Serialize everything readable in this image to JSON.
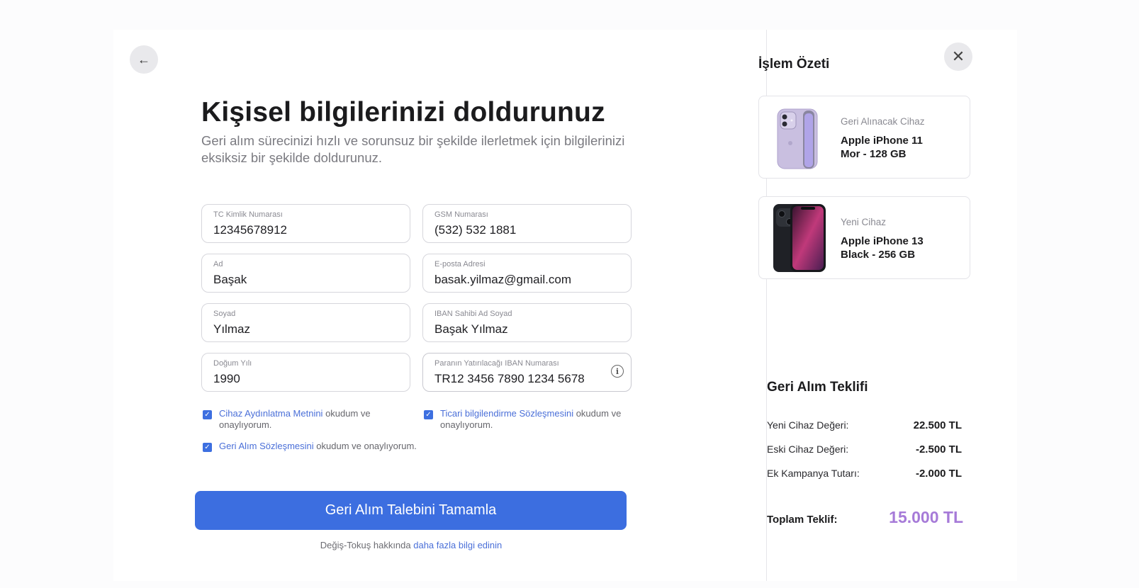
{
  "back_icon": "arrow-left-icon",
  "close_icon": "close-icon",
  "title": "Kişisel bilgilerinizi doldurunuz",
  "subtitle": "Geri alım sürecinizi hızlı ve sorunsuz bir şekilde ilerletmek için bilgilerinizi eksiksiz bir şekilde doldurunuz.",
  "form": {
    "tc": {
      "label": "TC Kimlik Numarası",
      "value": "12345678912"
    },
    "gsm": {
      "label": "GSM Numarası",
      "value": "(532) 532 1881"
    },
    "ad": {
      "label": "Ad",
      "value": "Başak"
    },
    "email": {
      "label": "E-posta Adresi",
      "value": "basak.yilmaz@gmail.com"
    },
    "soyad": {
      "label": "Soyad",
      "value": "Yılmaz"
    },
    "iban_owner": {
      "label": "IBAN Sahibi Ad Soyad",
      "value": "Başak Yılmaz"
    },
    "birth_year": {
      "label": "Doğum Yılı",
      "value": "1990"
    },
    "iban": {
      "label": "Paranın Yatırılacağı IBAN Numarası",
      "value": "TR12 3456 7890 1234 5678",
      "info_icon": "info-icon"
    }
  },
  "consents": {
    "c1": {
      "link": "Cihaz Aydınlatma Metnini",
      "text": " okudum ve onaylıyorum.",
      "checked": true
    },
    "c2": {
      "link": "Ticari bilgilendirme Sözleşmesini",
      "text": " okudum ve onaylıyorum.",
      "checked": true
    },
    "c3": {
      "link": "Geri Alım Sözleşmesini",
      "text": " okudum ve onaylıyorum.",
      "checked": true
    }
  },
  "submit_label": "Geri Alım Talebini Tamamla",
  "footer": {
    "text": "Değiş-Tokuş hakkında ",
    "link": "daha fazla bilgi edinin"
  },
  "summary": {
    "title": "İşlem Özeti",
    "old_device": {
      "caption": "Geri Alınacak Cihaz",
      "name_line1": "Apple iPhone 11",
      "name_line2": "Mor - 128 GB",
      "color": "#c9bfe0"
    },
    "new_device": {
      "caption": "Yeni Cihaz",
      "name_line1": "Apple iPhone 13",
      "name_line2": "Black - 256 GB",
      "color": "#1f2126"
    }
  },
  "offer": {
    "title": "Geri Alım Teklifi",
    "rows": [
      {
        "label": "Yeni Cihaz Değeri:",
        "value": "22.500 TL"
      },
      {
        "label": "Eski Cihaz Değeri:",
        "value": "-2.500 TL"
      },
      {
        "label": "Ek Kampanya Tutarı:",
        "value": "-2.000 TL"
      }
    ],
    "total_label": "Toplam Teklif:",
    "total_value": "15.000 TL"
  },
  "colors": {
    "accent": "#3c6ee0",
    "total": "#a67ad8"
  }
}
